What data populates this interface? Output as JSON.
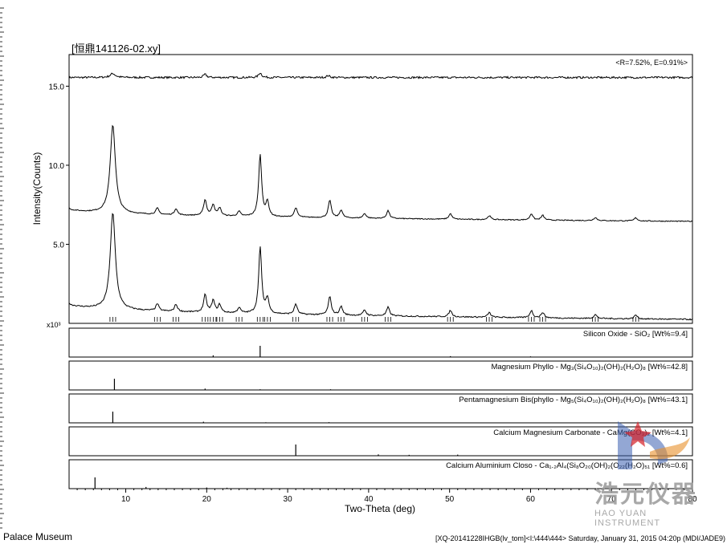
{
  "chart_data": {
    "type": "line",
    "file_title": "[恒鼎141126-02.xy]",
    "fit_stats": "<R=7.52%, E=0.91%>",
    "xlabel": "Two-Theta (deg)",
    "ylabel": "Intensity(Counts)",
    "y_multiplier": "x10³",
    "xlim": [
      3,
      80
    ],
    "ylim": [
      0,
      17.0
    ],
    "x_ticks": [
      "10",
      "20",
      "30",
      "40",
      "50",
      "60",
      "70",
      "80"
    ],
    "y_ticks": [
      "5.0",
      "10.0",
      "15.0"
    ],
    "series": [
      {
        "role": "difference",
        "baseline": 15.55,
        "peaks": [
          [
            8.4,
            0.25
          ],
          [
            19.8,
            0.2
          ],
          [
            26.6,
            0.3
          ],
          [
            35.0,
            0.12
          ]
        ]
      },
      {
        "role": "calculated",
        "baseline_start": 7.3,
        "baseline_end": 6.45,
        "peaks": [
          [
            8.4,
            5.6
          ],
          [
            13.9,
            0.4
          ],
          [
            16.2,
            0.4
          ],
          [
            19.8,
            1.0
          ],
          [
            20.8,
            0.7
          ],
          [
            21.6,
            0.5
          ],
          [
            24.0,
            0.3
          ],
          [
            26.6,
            3.9
          ],
          [
            27.5,
            0.9
          ],
          [
            31.0,
            0.6
          ],
          [
            35.2,
            1.1
          ],
          [
            36.6,
            0.5
          ],
          [
            39.5,
            0.3
          ],
          [
            42.4,
            0.5
          ],
          [
            50.1,
            0.35
          ],
          [
            54.9,
            0.25
          ],
          [
            60.1,
            0.4
          ],
          [
            61.5,
            0.3
          ],
          [
            68.0,
            0.2
          ],
          [
            73.0,
            0.2
          ]
        ]
      },
      {
        "role": "observed",
        "baseline_start": 1.3,
        "baseline_end": 0.25,
        "peaks": [
          [
            8.4,
            6.1
          ],
          [
            13.9,
            0.45
          ],
          [
            16.2,
            0.45
          ],
          [
            19.8,
            1.1
          ],
          [
            20.8,
            0.75
          ],
          [
            21.6,
            0.5
          ],
          [
            24.0,
            0.35
          ],
          [
            26.6,
            4.2
          ],
          [
            27.5,
            0.95
          ],
          [
            31.0,
            0.65
          ],
          [
            35.2,
            1.15
          ],
          [
            36.6,
            0.55
          ],
          [
            39.5,
            0.35
          ],
          [
            42.4,
            0.55
          ],
          [
            50.1,
            0.4
          ],
          [
            54.9,
            0.3
          ],
          [
            60.1,
            0.45
          ],
          [
            61.5,
            0.35
          ],
          [
            68.0,
            0.25
          ],
          [
            73.0,
            0.25
          ]
        ]
      }
    ],
    "phases": [
      {
        "label": "Silicon Oxide - SiO₂ [Wt%=9.4]",
        "lines": [
          [
            26.6,
            1.0
          ],
          [
            20.8,
            0.15
          ],
          [
            50.1,
            0.08
          ],
          [
            60.0,
            0.06
          ]
        ]
      },
      {
        "label": "Magnesium Phyllo - Mg₃(Si₄O₁₀)₂(OH)₂(H₂O)₈ [Wt%=42.8]",
        "lines": [
          [
            8.6,
            1.0
          ],
          [
            19.8,
            0.12
          ],
          [
            26.6,
            0.06
          ],
          [
            35.3,
            0.06
          ]
        ]
      },
      {
        "label": "Pentamagnesium Bis(phyllo - Mg₅(Si₄O₁₀)₂(OH)₂(H₂O)₈ [Wt%=43.1]",
        "lines": [
          [
            8.4,
            1.0
          ],
          [
            19.6,
            0.1
          ],
          [
            27.3,
            0.05
          ],
          [
            35.1,
            0.06
          ]
        ]
      },
      {
        "label": "Calcium Magnesium Carbonate - CaMg(CO₃)₂ [Wt%=4.1]",
        "lines": [
          [
            31.0,
            1.0
          ],
          [
            41.2,
            0.12
          ],
          [
            45.0,
            0.08
          ],
          [
            51.0,
            0.1
          ]
        ]
      },
      {
        "label": "Calcium Aluminium Closo - Ca₁.₂Al₄(Si₈O₂₀(OH)₂(O₂₂(H₂O)₅₁ [Wt%=0.6]",
        "lines": [
          [
            6.2,
            1.0
          ],
          [
            12.5,
            0.15
          ],
          [
            20.0,
            0.1
          ],
          [
            22.5,
            0.08
          ]
        ]
      }
    ],
    "grid": false,
    "legend": "none"
  },
  "footer": {
    "left": "Palace Museum",
    "right": "[XQ-20141228IHGB(lv_tom]<I:\\444\\444> Saturday, January 31, 2015 04:20p (MDI/JADE9)"
  },
  "logo": {
    "name": "浩元仪器",
    "subtitle": "HAO YUAN INSTRUMENT",
    "colors": {
      "blue": "#3a5fb0",
      "orange": "#e8902a",
      "red": "#d42027",
      "gray": "#a8a8a8"
    }
  }
}
